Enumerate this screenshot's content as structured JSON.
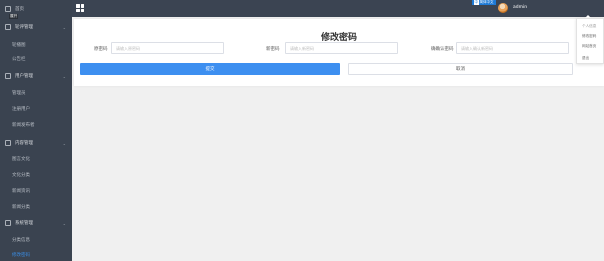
{
  "sidebar": {
    "home": "首页",
    "hint": "展开",
    "items": [
      {
        "label": "轮评管理",
        "type": "group"
      },
      {
        "label": "轮播图",
        "type": "sub"
      },
      {
        "label": "公告栏",
        "type": "sub"
      },
      {
        "label": "用户管理",
        "type": "group"
      },
      {
        "label": "管理员",
        "type": "sub"
      },
      {
        "label": "注册用户",
        "type": "sub"
      },
      {
        "label": "新闻发布者",
        "type": "sub"
      },
      {
        "label": "内容管理",
        "type": "group"
      },
      {
        "label": "图言文化",
        "type": "sub"
      },
      {
        "label": "文化分类",
        "type": "sub"
      },
      {
        "label": "新闻资讯",
        "type": "sub"
      },
      {
        "label": "新闻分类",
        "type": "sub"
      },
      {
        "label": "系统管理",
        "type": "group"
      },
      {
        "label": "分类信息",
        "type": "sub"
      },
      {
        "label": "修改密码",
        "type": "sub",
        "active": true
      }
    ]
  },
  "topbar": {
    "lang_badge_letter": "中",
    "lang_badge_text": "简体中文",
    "username": "admin"
  },
  "dropdown": {
    "items": [
      "个人信息",
      "修改密码",
      "网站首页",
      "退出"
    ]
  },
  "form": {
    "title": "修改密码",
    "fields": [
      {
        "label": "原密码",
        "placeholder": "请输入原密码"
      },
      {
        "label": "新密码",
        "placeholder": "请输入新密码"
      },
      {
        "label": "确确认密码",
        "placeholder": "请输入确认新密码"
      }
    ],
    "submit_label": "提交",
    "cancel_label": "取消"
  },
  "colors": {
    "sidebar_bg": "#3a4350",
    "topbar_bg": "#3b4452",
    "primary": "#3d8ff0",
    "active_link": "#3a8ee6"
  }
}
